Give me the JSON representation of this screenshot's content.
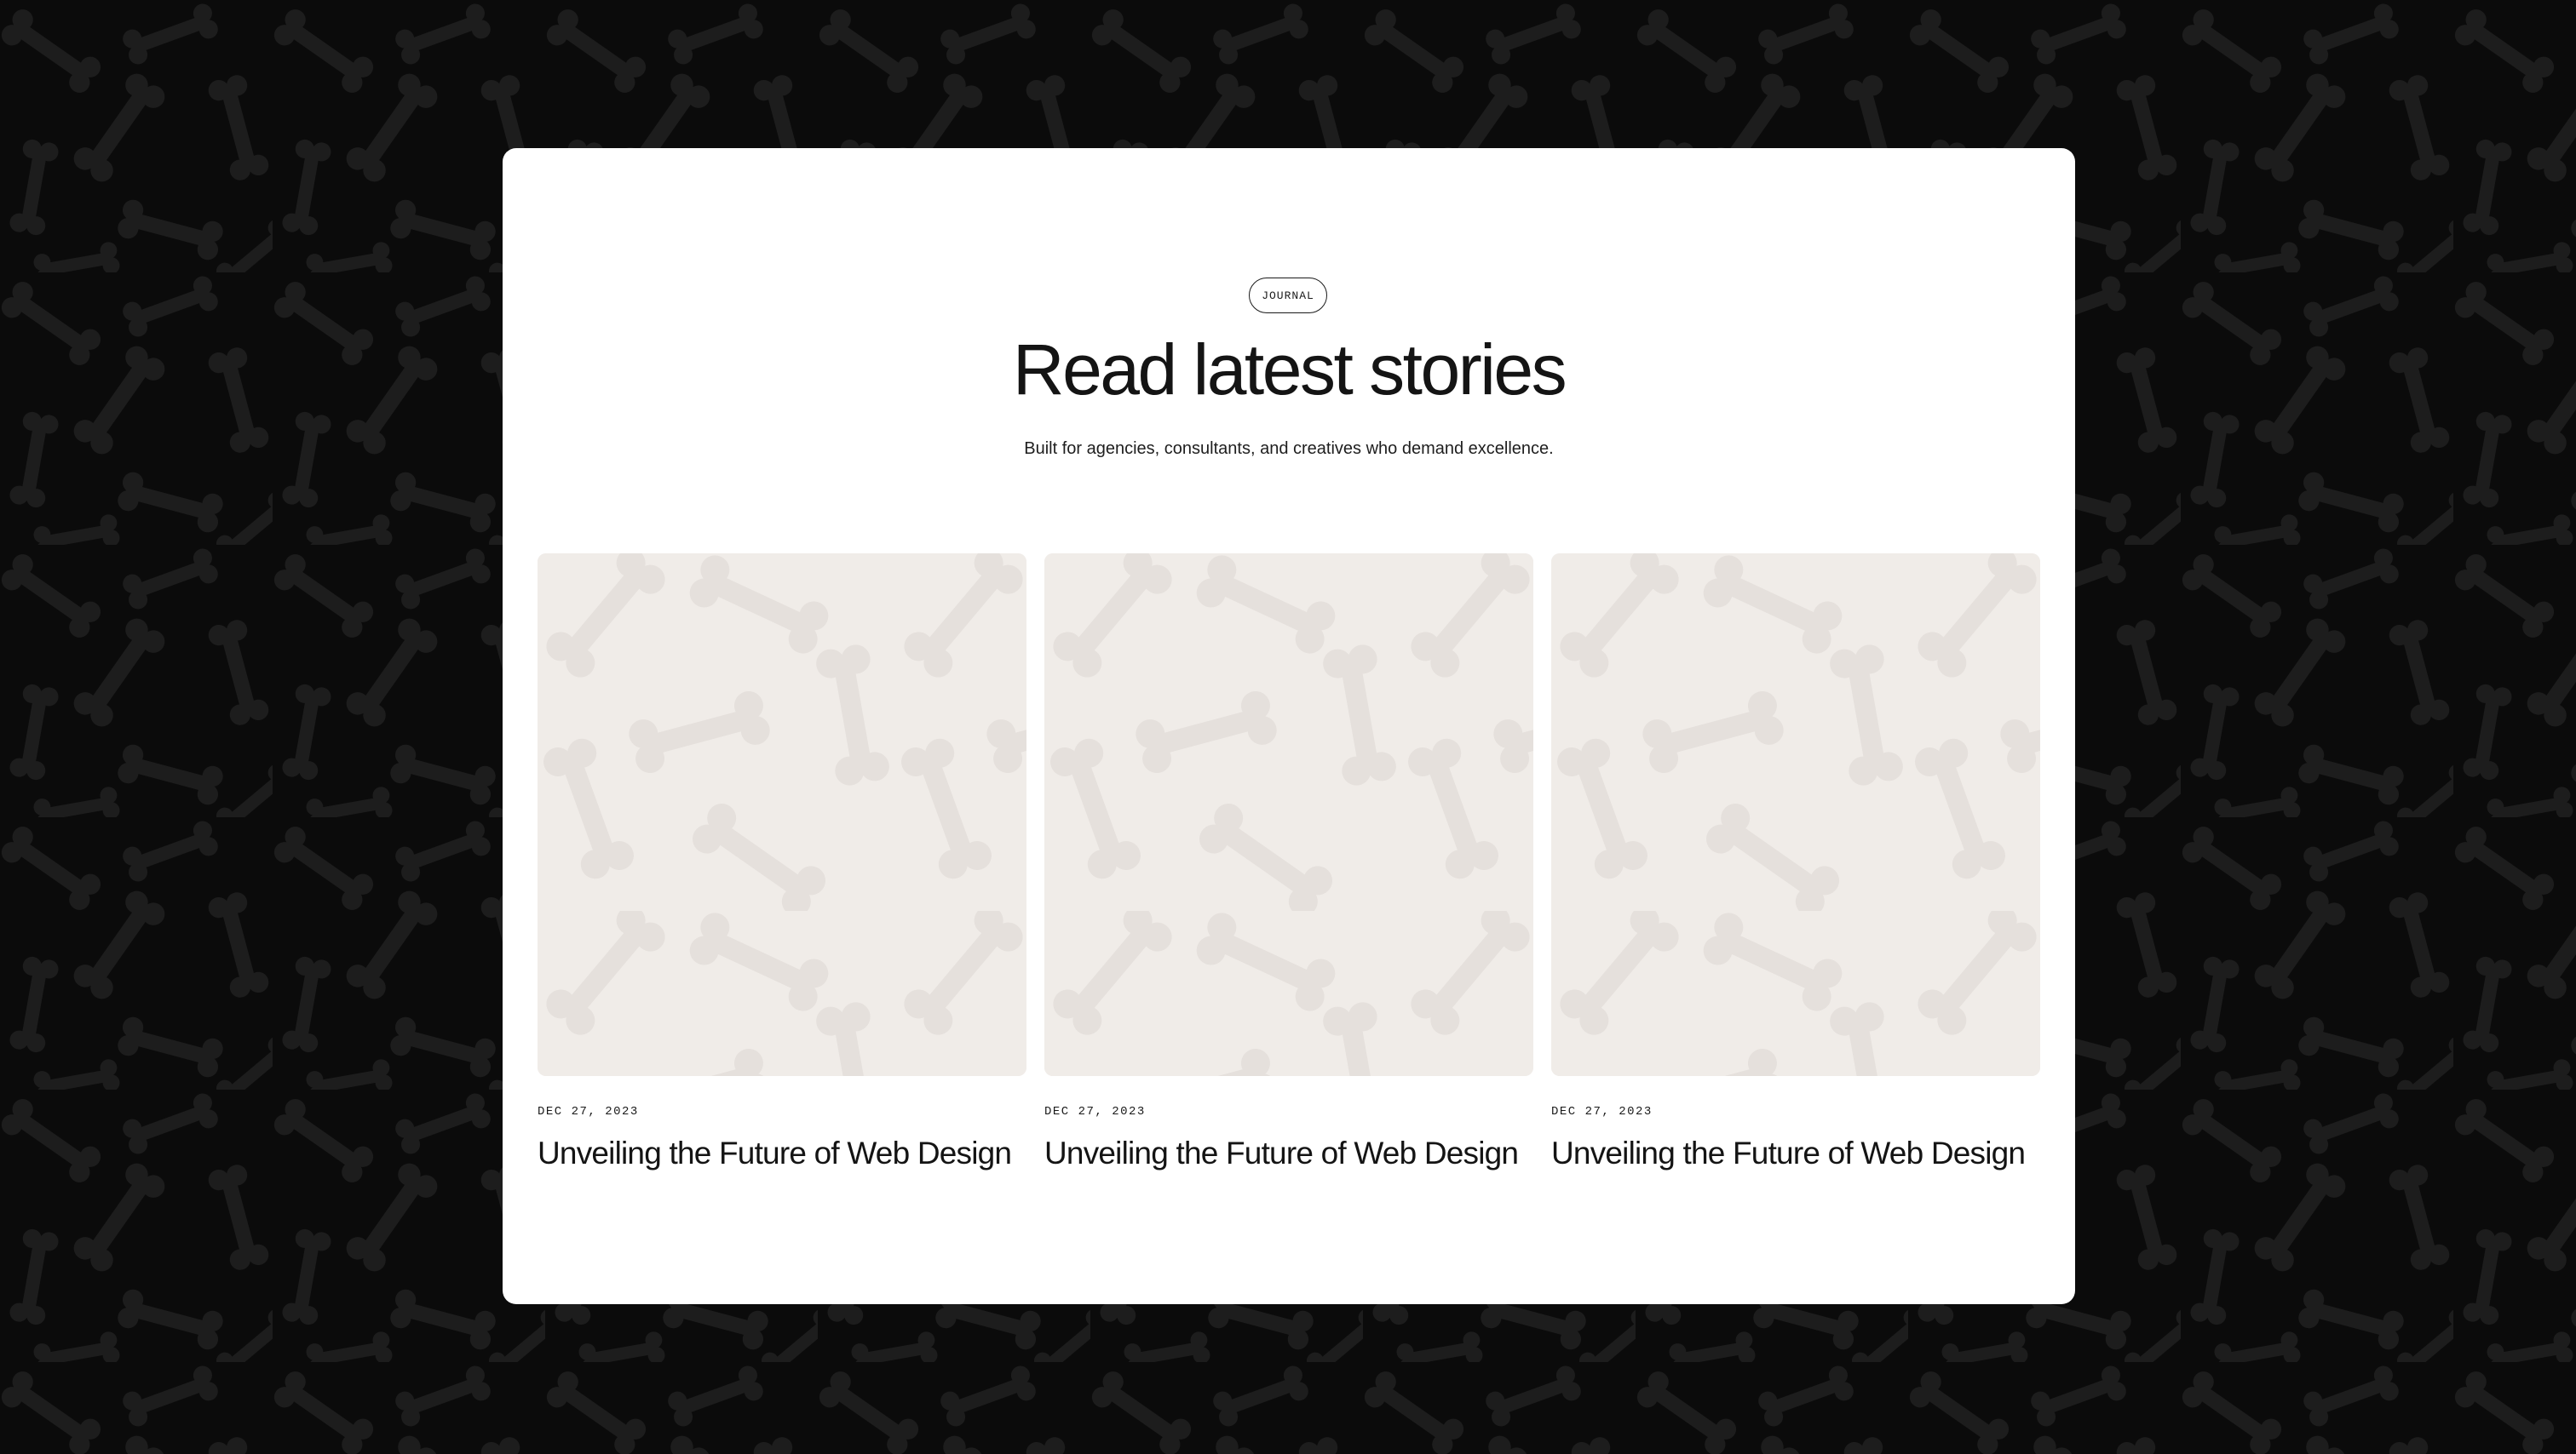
{
  "theme": {
    "page_background": "#0b0b0b",
    "pattern_dark": "#1d1d1d",
    "card_background": "#ffffff",
    "thumb_background": "#f0ece8",
    "thumb_pattern": "#e5e0dc",
    "text": "#141414"
  },
  "section": {
    "badge": "JOURNAL",
    "heading": "Read latest stories",
    "subtitle": "Built for agencies, consultants, and creatives who demand excellence."
  },
  "posts": [
    {
      "date": "DEC 27, 2023",
      "title": "Unveiling the Future of Web Design",
      "image_icon": "bone-pattern-image"
    },
    {
      "date": "DEC 27, 2023",
      "title": "Unveiling the Future of Web Design",
      "image_icon": "bone-pattern-image"
    },
    {
      "date": "DEC 27, 2023",
      "title": "Unveiling the Future of Web Design",
      "image_icon": "bone-pattern-image"
    }
  ]
}
